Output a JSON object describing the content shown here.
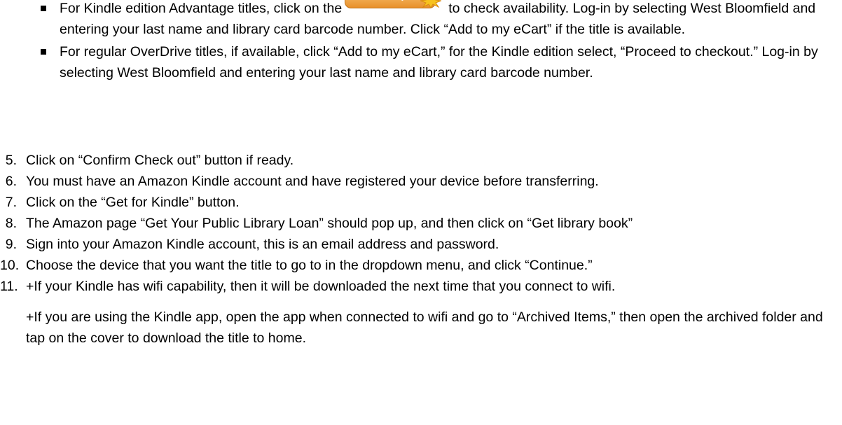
{
  "bullets": [
    {
      "before": "For Kindle edition Advantage titles, click on the",
      "button_label": "availability",
      "after": "to check availability. Log-in by selecting West Bloomfield and entering your last name and library card barcode number. Click “Add to my eCart” if the title is available."
    },
    {
      "text": "For regular OverDrive titles, if available, click “Add to my eCart,” for the Kindle edition select, “Proceed to checkout.” Log-in by selecting West Bloomfield and entering your last name and library card barcode number."
    }
  ],
  "steps": [
    {
      "num": "5.",
      "text": "Click on “Confirm Check out” button if ready."
    },
    {
      "num": "6.",
      "text": "You must have an Amazon Kindle account and have registered your device before transferring."
    },
    {
      "num": "7.",
      "text": "Click on the “Get for Kindle” button."
    },
    {
      "num": "8.",
      "text": "The Amazon page “Get Your Public Library Loan” should pop up, and then click on “Get library book”"
    },
    {
      "num": "9.",
      "text": "Sign into your Amazon Kindle account, this is an email address and password."
    },
    {
      "num": "10.",
      "text": "Choose the device that you want the title to go to in the dropdown menu, and click “Continue.”"
    },
    {
      "num": "11.",
      "text": "+If your Kindle has wifi capability, then it will be downloaded the next time that you connect to wifi.",
      "text2": "+If you are using the Kindle app, open the app when connected to wifi and go to “Archived Items,” then open the archived folder and tap on the cover to download the title to home."
    }
  ],
  "colors": {
    "button_orange": "#e8902a",
    "star_yellow": "#f7c21e"
  }
}
